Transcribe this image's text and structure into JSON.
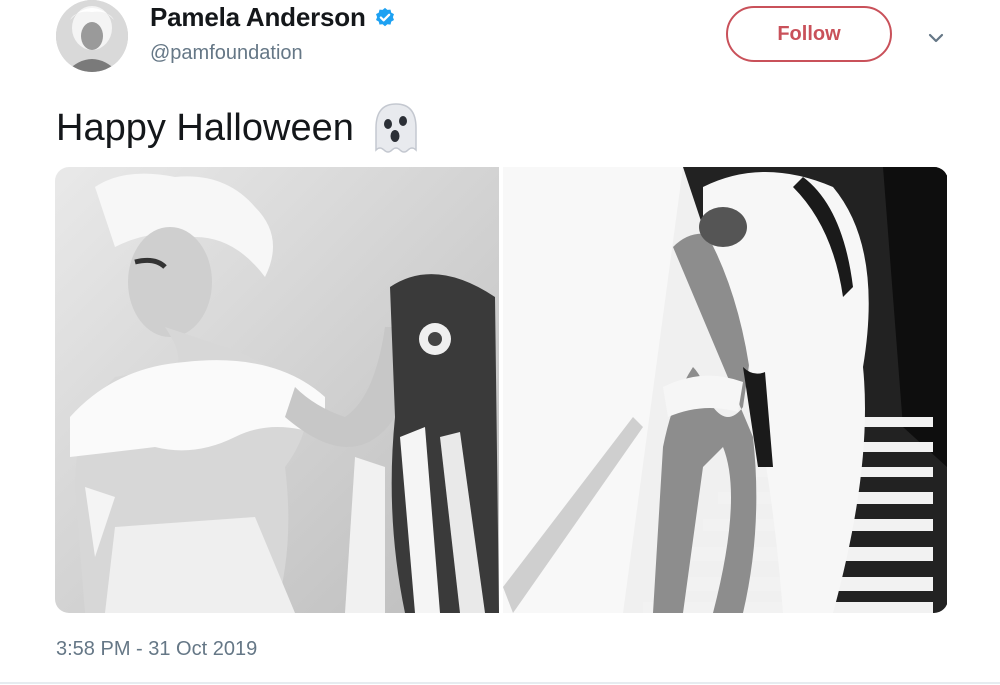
{
  "user": {
    "display_name": "Pamela Anderson",
    "handle": "@pamfoundation",
    "verified": true,
    "verified_color": "#1da1f2"
  },
  "actions": {
    "follow_label": "Follow",
    "follow_color": "#c9515a"
  },
  "tweet": {
    "text": "Happy Halloween",
    "emoji": "ghost-emoji",
    "timestamp": "3:58 PM - 31 Oct 2019"
  },
  "media": {
    "photos": [
      {
        "alt_icon": "photo-woman-headdress-icon"
      },
      {
        "alt_icon": "photo-woman-staircase-icon"
      }
    ]
  }
}
